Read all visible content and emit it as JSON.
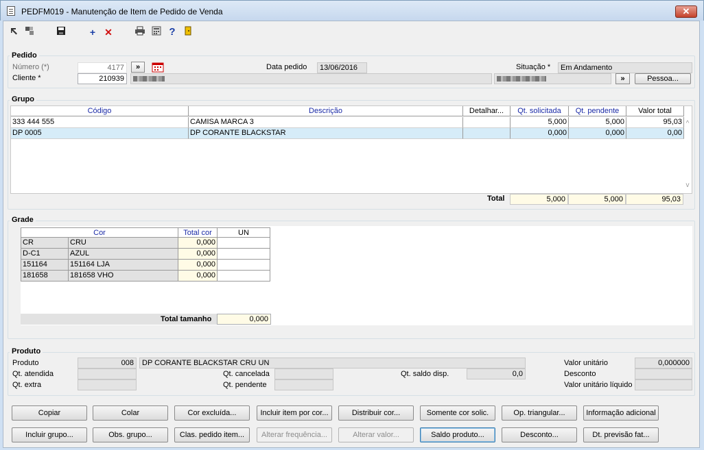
{
  "window": {
    "title": "PEDFM019 - Manutenção de Item de Pedido de Venda",
    "close_label": "✕"
  },
  "toolbar": {
    "add_label": "+",
    "delete_label": "✕",
    "help_label": "?"
  },
  "pedido": {
    "section_label": "Pedido",
    "numero_label": "Número (*)",
    "numero_value": "4177",
    "cliente_label": "Cliente *",
    "cliente_value": "210939",
    "data_label": "Data pedido",
    "data_value": "13/06/2016",
    "situacao_label": "Situação *",
    "situacao_value": "Em Andamento",
    "arrow_label": "»",
    "arrow2_label": "»",
    "pessoa_button": "Pessoa..."
  },
  "grupo": {
    "section_label": "Grupo",
    "columns": [
      "Código",
      "Descrição",
      "Detalhar...",
      "Qt. solicitada",
      "Qt. pendente",
      "Valor total"
    ],
    "rows": [
      [
        "333 444 555",
        "CAMISA MARCA 3",
        "",
        "5,000",
        "5,000",
        "95,03"
      ],
      [
        "DP 0005",
        "DP CORANTE BLACKSTAR",
        "",
        "0,000",
        "0,000",
        "0,00"
      ]
    ],
    "total_label": "Total",
    "totals": [
      "5,000",
      "5,000",
      "95,03"
    ]
  },
  "grade": {
    "section_label": "Grade",
    "columns": [
      "Cor",
      "Total cor",
      "UN"
    ],
    "rows": [
      [
        "CR",
        "CRU",
        "0,000",
        ""
      ],
      [
        "D-C1",
        "AZUL",
        "0,000",
        ""
      ],
      [
        "151164",
        "151164 LJA",
        "0,000",
        ""
      ],
      [
        "181658",
        "181658 VHO",
        "0,000",
        ""
      ]
    ],
    "total_label": "Total tamanho",
    "total_value": "0,000"
  },
  "produto": {
    "section_label": "Produto",
    "produto_label": "Produto",
    "produto_code": "008",
    "produto_desc": "DP CORANTE BLACKSTAR CRU UN",
    "qt_atendida_label": "Qt. atendida",
    "qt_extra_label": "Qt. extra",
    "qt_cancelada_label": "Qt. cancelada",
    "qt_pendente_label": "Qt. pendente",
    "qt_saldo_label": "Qt. saldo disp.",
    "qt_saldo_value": "0,0",
    "valor_unitario_label": "Valor unitário",
    "valor_unitario_value": "0,000000",
    "desconto_label": "Desconto",
    "valor_liquido_label": "Valor unitário líquido"
  },
  "buttons_row1": [
    "Copiar",
    "Colar",
    "Cor excluída...",
    "Incluir item por cor...",
    "Distribuir cor...",
    "Somente cor solic.",
    "Op. triangular...",
    "Informação adicional"
  ],
  "buttons_row2": [
    "Incluir grupo...",
    "Obs. grupo...",
    "Clas. pedido item...",
    "Alterar frequência...",
    "Alterar valor...",
    "Saldo produto...",
    "Desconto...",
    "Dt. previsão fat..."
  ]
}
